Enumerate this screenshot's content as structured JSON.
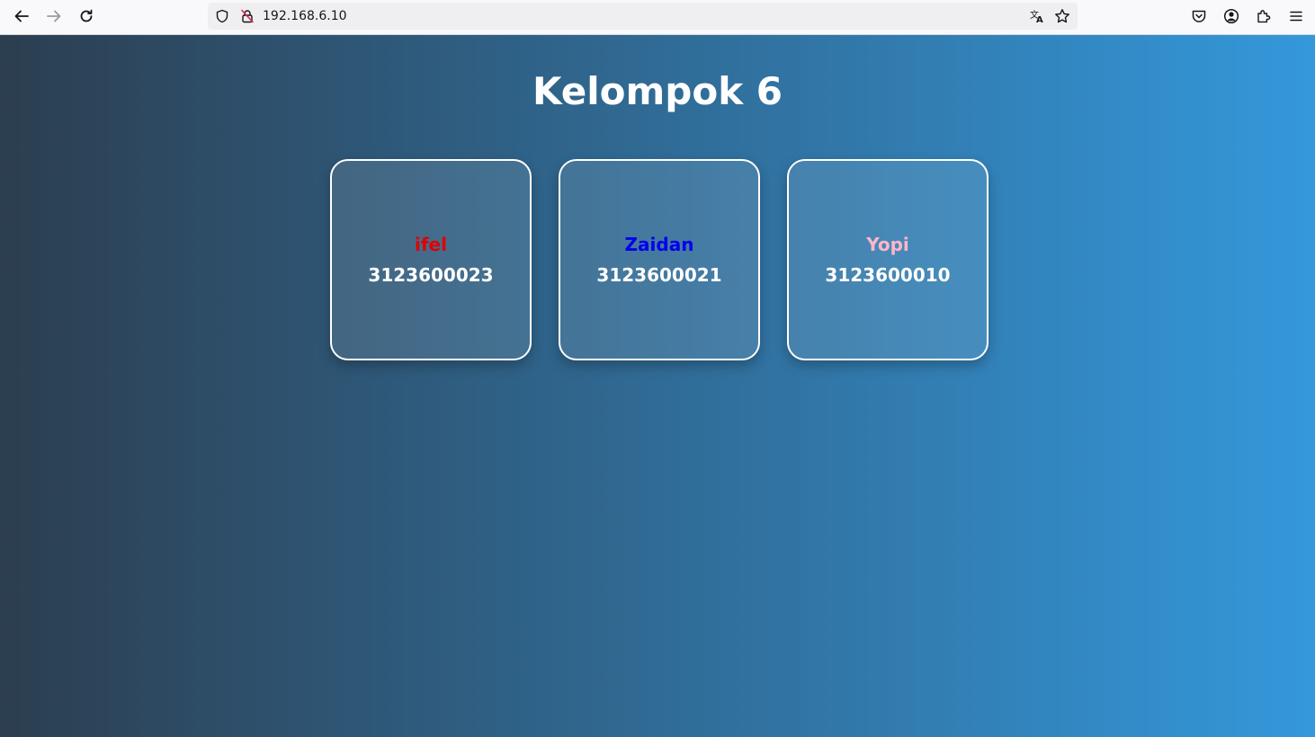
{
  "browser": {
    "url": "192.168.6.10",
    "icons": {
      "back": "back-arrow-icon",
      "forward": "forward-arrow-icon",
      "reload": "reload-icon",
      "tracking": "shield-icon",
      "insecure": "insecure-lock-icon",
      "translate": "translate-icon",
      "bookmark": "star-icon",
      "pocket": "pocket-icon",
      "account": "account-icon",
      "extensions": "puzzle-icon",
      "menu": "hamburger-menu-icon"
    }
  },
  "page": {
    "title": "Kelompok 6",
    "background_gradient": [
      "#2c3e50",
      "#3498db"
    ],
    "members": [
      {
        "name": "ifel",
        "nim": "3123600023",
        "name_color": "#e00000"
      },
      {
        "name": "Zaidan",
        "nim": "3123600021",
        "name_color": "#0000ee"
      },
      {
        "name": "Yopi",
        "nim": "3123600010",
        "name_color": "#ffb6c8"
      }
    ]
  }
}
